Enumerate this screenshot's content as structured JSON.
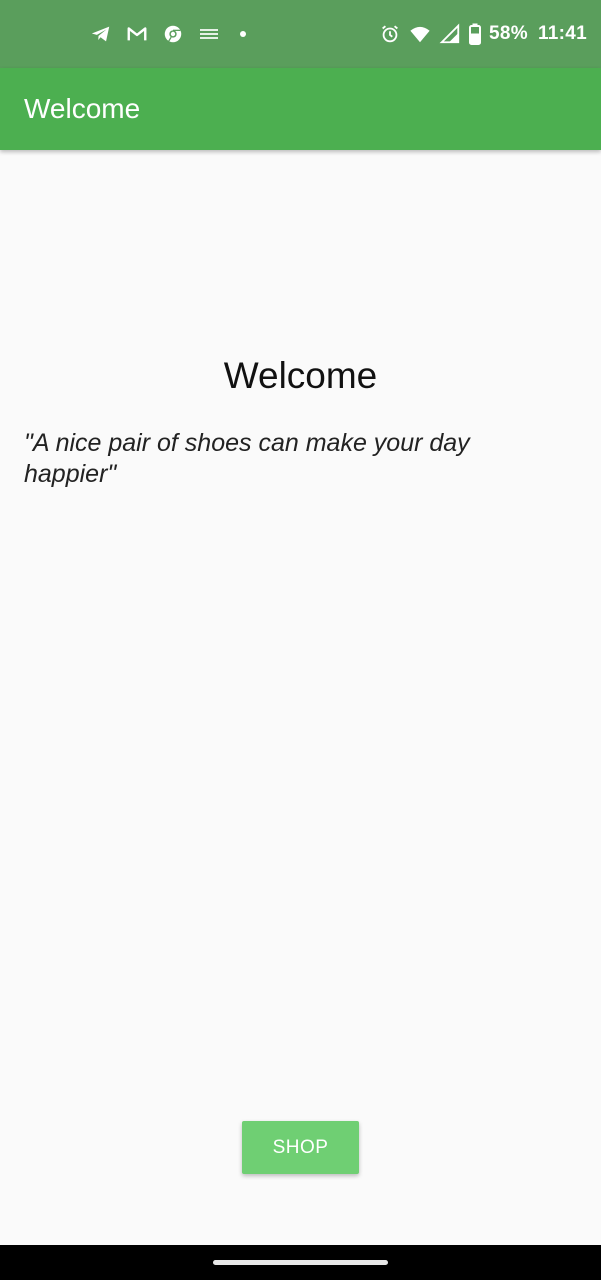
{
  "status_bar": {
    "notification_icons": [
      "telegram-icon",
      "gmail-icon",
      "chrome-icon",
      "app-logo-icon",
      "more-notifications-dot"
    ],
    "system_icons": [
      "alarm-icon",
      "wifi-icon",
      "signal-icon",
      "battery-icon"
    ],
    "battery": "58%",
    "time": "11:41"
  },
  "app_bar": {
    "title": "Welcome"
  },
  "main": {
    "heading": "Welcome",
    "quote": "\"A nice pair of shoes can make your day happier\"",
    "shop_button": "SHOP"
  },
  "colors": {
    "status_bar": "#5a9e5c",
    "app_bar": "#4caf50",
    "button": "#6fcf73",
    "background": "#fafafa"
  }
}
